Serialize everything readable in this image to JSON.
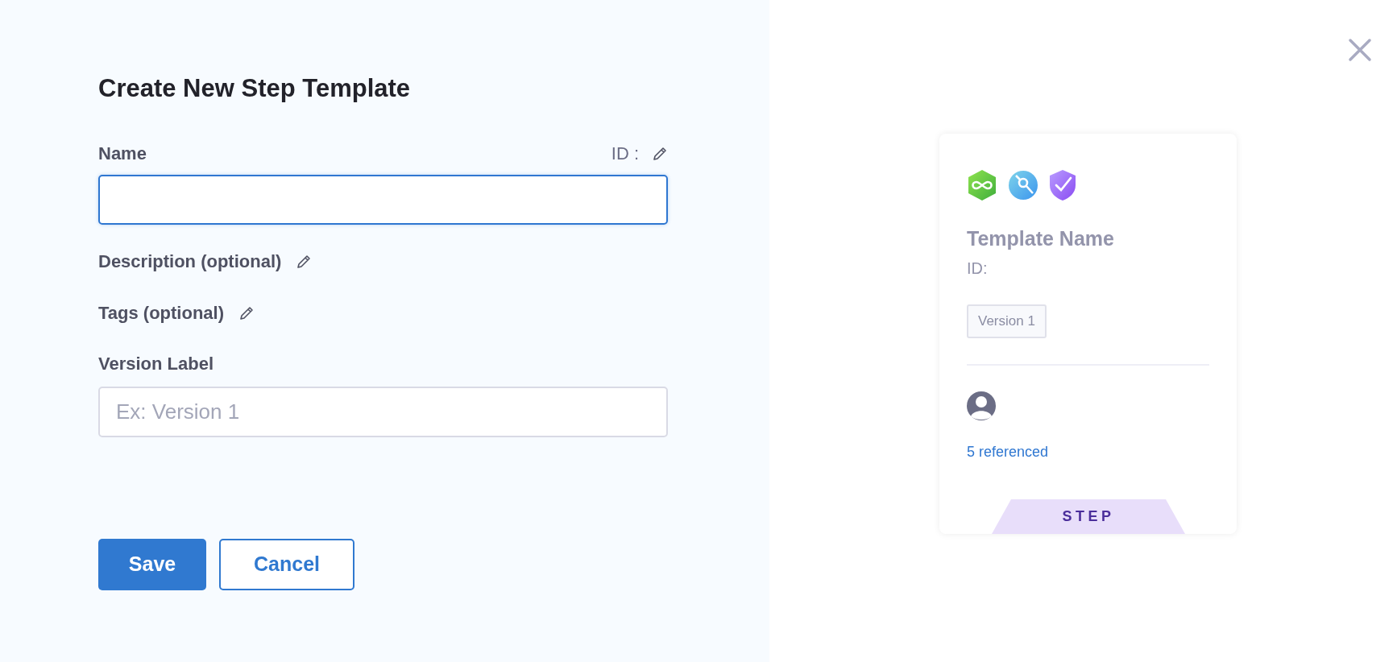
{
  "form": {
    "title": "Create New Step Template",
    "name_field": {
      "label": "Name",
      "id_label": "ID :",
      "focused": true
    },
    "optional_fields": [
      {
        "label": "Description (optional)"
      },
      {
        "label": "Tags (optional)"
      }
    ],
    "version_field": {
      "label": "Version Label",
      "placeholder": "Ex: Version 1"
    },
    "buttons": [
      {
        "label": "Save",
        "kind": "primary"
      },
      {
        "label": "Cancel",
        "kind": "secondary"
      }
    ]
  },
  "preview_card": {
    "title": "Template Name",
    "id_label": "ID:",
    "version": "Version 1",
    "referenced": "5 referenced",
    "type_tab": "STEP"
  }
}
